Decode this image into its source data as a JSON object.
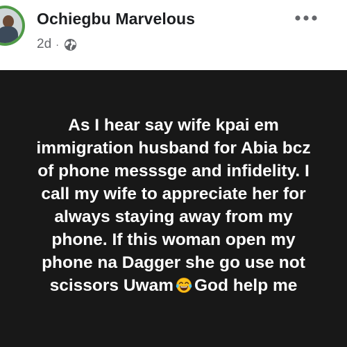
{
  "post": {
    "author_name": "Ochiegbu Marvelous",
    "time_ago": "2d",
    "separator": "·",
    "privacy_icon": "globe-icon",
    "more_icon": "more-options-icon",
    "body_lines": [
      "As I hear say wife kpai em",
      "immigration husband for Abia bcz",
      "of phone messsge and infidelity. I",
      "call my wife to appreciate her for",
      "always staying away from my",
      "phone.   If this woman open my",
      "phone na Dagger she go use not"
    ],
    "last_line_before_emoji": "scissors Uwam",
    "emoji_icon": "tears-of-joy-emoji-icon",
    "last_line_after_emoji": "God help me"
  },
  "colors": {
    "body_background": "#181818",
    "body_text": "#ffffff",
    "name_text": "#1c1e21",
    "meta_text": "#65676b",
    "avatar_ring": "#4f9a47"
  }
}
